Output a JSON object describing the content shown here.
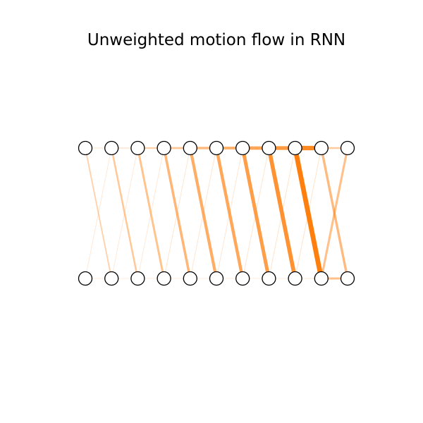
{
  "title": "Unweighted motion flow in RNN",
  "colors": {
    "edge": "#ff7f0e",
    "node_fill": "#ffffff",
    "node_stroke": "#000000",
    "background": "#ffffff"
  },
  "graph": {
    "top_row_node_count": 11,
    "bottom_row_node_count": 11,
    "edges": [
      {
        "from": "top-0",
        "to": "bottom-1",
        "weight": 0.22
      },
      {
        "from": "top-1",
        "to": "bottom-2",
        "weight": 0.32
      },
      {
        "from": "top-2",
        "to": "bottom-3",
        "weight": 0.38
      },
      {
        "from": "top-3",
        "to": "bottom-4",
        "weight": 0.48
      },
      {
        "from": "top-4",
        "to": "bottom-5",
        "weight": 0.58
      },
      {
        "from": "top-5",
        "to": "bottom-6",
        "weight": 0.62
      },
      {
        "from": "top-6",
        "to": "bottom-7",
        "weight": 0.72
      },
      {
        "from": "top-7",
        "to": "bottom-8",
        "weight": 0.82
      },
      {
        "from": "top-8",
        "to": "bottom-9",
        "weight": 1.0
      },
      {
        "from": "top-9",
        "to": "bottom-10",
        "weight": 0.45
      },
      {
        "from": "bottom-0",
        "to": "top-1",
        "weight": 0.05
      },
      {
        "from": "bottom-1",
        "to": "top-2",
        "weight": 0.05
      },
      {
        "from": "bottom-2",
        "to": "top-3",
        "weight": 0.05
      },
      {
        "from": "bottom-3",
        "to": "top-4",
        "weight": 0.06
      },
      {
        "from": "bottom-4",
        "to": "top-5",
        "weight": 0.06
      },
      {
        "from": "bottom-5",
        "to": "top-6",
        "weight": 0.06
      },
      {
        "from": "bottom-6",
        "to": "top-7",
        "weight": 0.06
      },
      {
        "from": "bottom-7",
        "to": "top-8",
        "weight": 0.07
      },
      {
        "from": "bottom-8",
        "to": "top-9",
        "weight": 0.07
      },
      {
        "from": "bottom-9",
        "to": "top-10",
        "weight": 0.4
      },
      {
        "from": "top-0",
        "to": "top-1",
        "weight": 0.08
      },
      {
        "from": "top-1",
        "to": "top-2",
        "weight": 0.12
      },
      {
        "from": "top-2",
        "to": "top-3",
        "weight": 0.25
      },
      {
        "from": "top-3",
        "to": "top-4",
        "weight": 0.35
      },
      {
        "from": "top-4",
        "to": "top-5",
        "weight": 0.45
      },
      {
        "from": "top-5",
        "to": "top-6",
        "weight": 0.55
      },
      {
        "from": "top-6",
        "to": "top-7",
        "weight": 0.65
      },
      {
        "from": "top-7",
        "to": "top-8",
        "weight": 0.75
      },
      {
        "from": "top-8",
        "to": "top-9",
        "weight": 0.9
      },
      {
        "from": "top-9",
        "to": "top-10",
        "weight": 0.3
      },
      {
        "from": "bottom-0",
        "to": "bottom-1",
        "weight": 0.03
      },
      {
        "from": "bottom-1",
        "to": "bottom-2",
        "weight": 0.03
      },
      {
        "from": "bottom-2",
        "to": "bottom-3",
        "weight": 0.03
      },
      {
        "from": "bottom-3",
        "to": "bottom-4",
        "weight": 0.03
      },
      {
        "from": "bottom-4",
        "to": "bottom-5",
        "weight": 0.03
      },
      {
        "from": "bottom-5",
        "to": "bottom-6",
        "weight": 0.03
      },
      {
        "from": "bottom-6",
        "to": "bottom-7",
        "weight": 0.03
      },
      {
        "from": "bottom-7",
        "to": "bottom-8",
        "weight": 0.03
      },
      {
        "from": "bottom-8",
        "to": "bottom-9",
        "weight": 0.05
      },
      {
        "from": "bottom-9",
        "to": "bottom-10",
        "weight": 0.4
      }
    ]
  }
}
